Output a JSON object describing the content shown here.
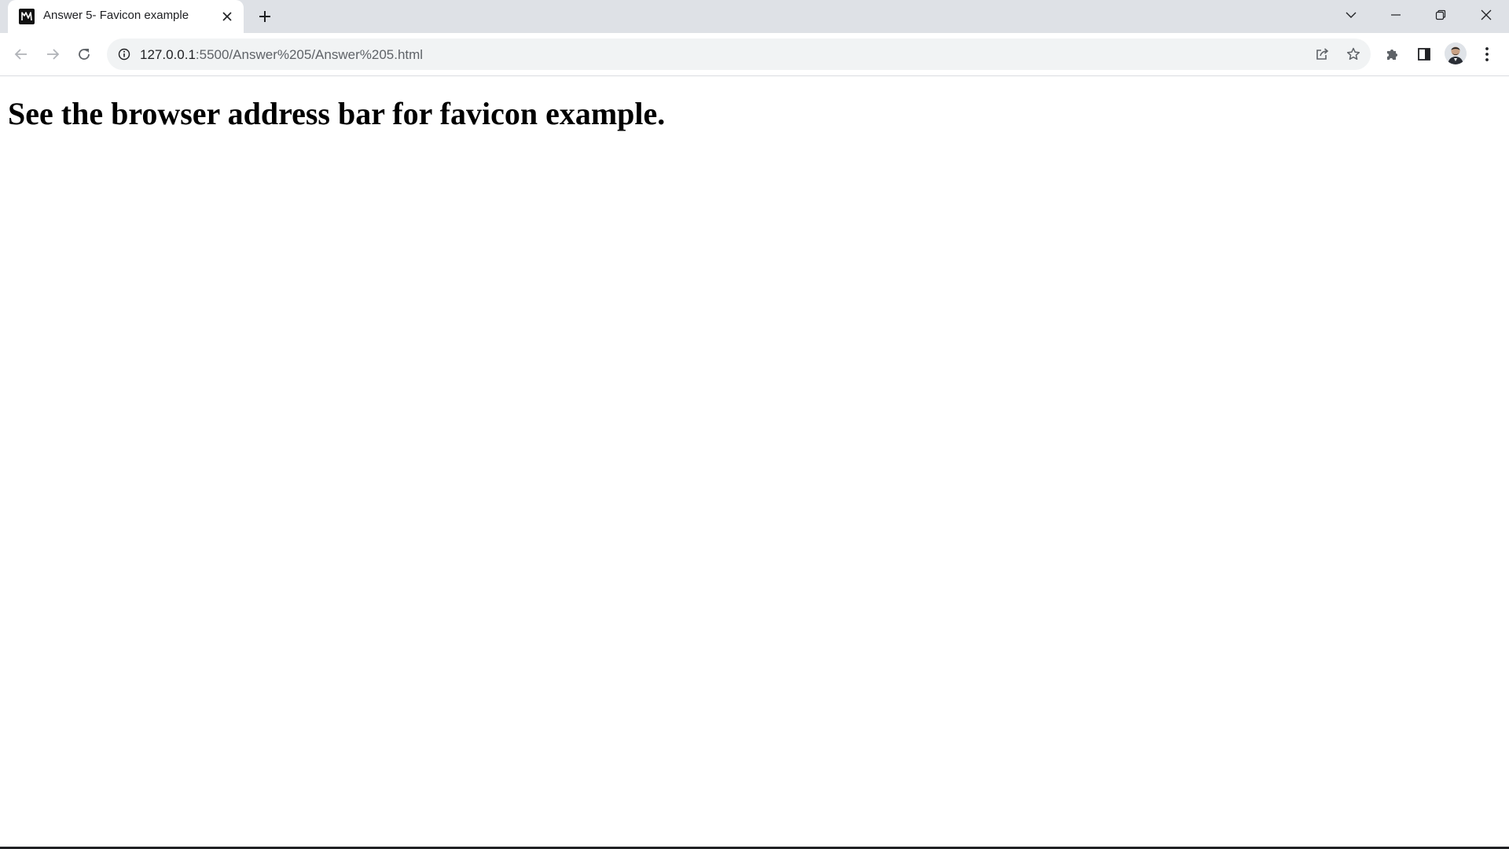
{
  "tab": {
    "title": "Answer 5- Favicon example",
    "favicon": "km-logo-icon",
    "close_icon": "close-icon"
  },
  "new_tab_icon": "plus-icon",
  "window_controls": {
    "tab_search_icon": "chevron-down-icon",
    "minimize_icon": "minimize-icon",
    "restore_icon": "restore-icon",
    "close_icon": "close-icon"
  },
  "toolbar": {
    "back_icon": "arrow-left-icon",
    "forward_icon": "arrow-right-icon",
    "reload_icon": "reload-icon",
    "address": {
      "host": "127.0.0.1",
      "path": ":5500/Answer%205/Answer%205.html",
      "site_info_icon": "info-icon"
    },
    "share_icon": "share-icon",
    "bookmark_icon": "star-icon",
    "extensions_icon": "puzzle-icon",
    "side_panel_icon": "side-panel-icon",
    "profile_icon": "avatar-icon",
    "menu_icon": "kebab-menu-icon"
  },
  "page": {
    "heading": "See the browser address bar for favicon example."
  }
}
